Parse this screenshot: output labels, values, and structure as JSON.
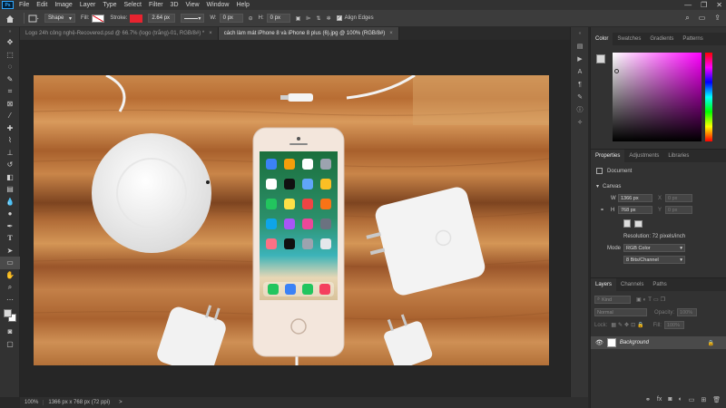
{
  "menu": {
    "logo": "Ps",
    "items": [
      "File",
      "Edit",
      "Image",
      "Layer",
      "Type",
      "Select",
      "Filter",
      "3D",
      "View",
      "Window",
      "Help"
    ]
  },
  "options": {
    "mode": "Shape",
    "fill_label": "Fill:",
    "stroke_label": "Stroke:",
    "stroke_width": "2.64 px",
    "w_label": "W:",
    "w_value": "0 px",
    "h_label": "H:",
    "h_value": "0 px",
    "align_edges": "Align Edges"
  },
  "tabs": [
    {
      "label": "Logo 24h công nghệ-Recovered.psd @ 66.7% (logo (trắng)-01, RGB/8#) *",
      "close": "×"
    },
    {
      "label": "cách làm mát iPhone 8 và iPhone 8 plus (6).jpg @ 100% (RGB/8#)",
      "close": "×"
    }
  ],
  "status": {
    "zoom": "100%",
    "doc_info": "1366 px x 768 px (72 ppi)",
    "arrow": ">"
  },
  "color_panel": {
    "tabs": [
      "Color",
      "Swatches",
      "Gradients",
      "Patterns"
    ]
  },
  "properties": {
    "tabs": [
      "Properties",
      "Adjustments",
      "Libraries"
    ],
    "document_label": "Document",
    "canvas_label": "Canvas",
    "w_label": "W",
    "w_value": "1366 px",
    "x_label": "X",
    "x_value": "0 px",
    "h_label": "H",
    "h_value": "768 px",
    "y_label": "Y",
    "y_value": "0 px",
    "resolution": "Resolution: 72 pixels/inch",
    "mode_label": "Mode",
    "mode_value": "RGB Color",
    "depth_value": "8 Bits/Channel"
  },
  "layers": {
    "tabs": [
      "Layers",
      "Channels",
      "Paths"
    ],
    "kind": "Kind",
    "blend": "Normal",
    "opacity_label": "Opacity:",
    "opacity_value": "100%",
    "lock_label": "Lock:",
    "fill_label": "Fill:",
    "fill_value": "100%",
    "layer_name": "Background"
  },
  "colors": {
    "accent": "#31a8ff",
    "stroke_swatch": "#e8232f"
  }
}
